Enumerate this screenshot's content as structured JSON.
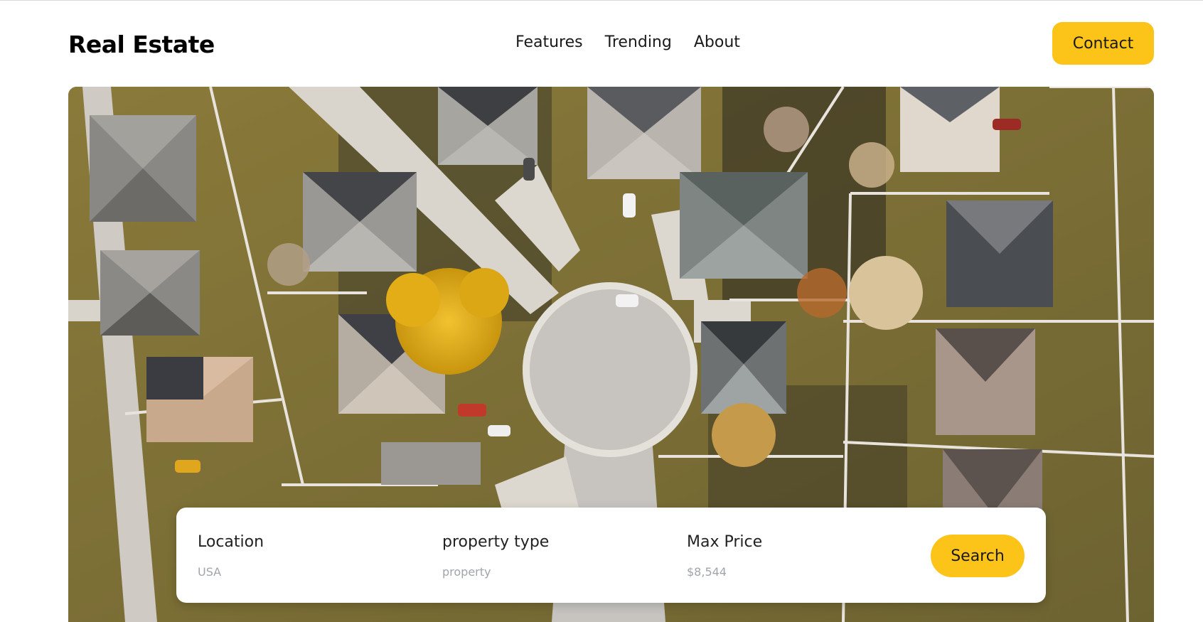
{
  "header": {
    "brand": "Real Estate",
    "nav": [
      "Features",
      "Trending",
      "About"
    ],
    "contact_label": "Contact"
  },
  "search": {
    "location_label": "Location",
    "location_placeholder": "USA",
    "property_label": "property type",
    "property_placeholder": "property",
    "price_label": "Max Price",
    "price_placeholder": "$8,544",
    "search_label": "Search"
  },
  "colors": {
    "accent": "#fcc419",
    "text": "#111111",
    "muted": "#8a8f98"
  }
}
